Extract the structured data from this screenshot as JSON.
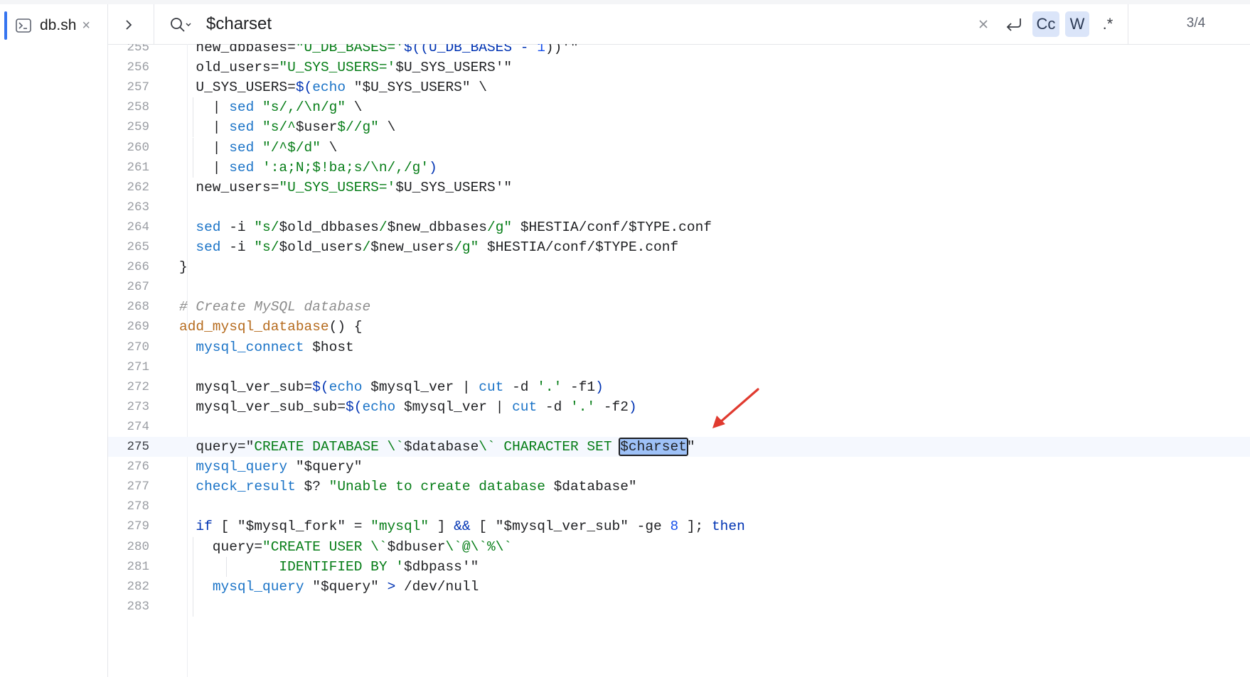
{
  "tab": {
    "label": "db.sh",
    "close": "×"
  },
  "search": {
    "query": "$charset",
    "match_counter": "3/4",
    "case_label": "Cc",
    "word_label": "W",
    "regex_label": ".*"
  },
  "editor": {
    "current_line": "275",
    "lines": [
      {
        "n": "255",
        "indent": 1
      },
      {
        "n": "256",
        "indent": 1
      },
      {
        "n": "257",
        "indent": 1
      },
      {
        "n": "258",
        "indent": 2
      },
      {
        "n": "259",
        "indent": 2
      },
      {
        "n": "260",
        "indent": 2
      },
      {
        "n": "261",
        "indent": 2
      },
      {
        "n": "262",
        "indent": 1
      },
      {
        "n": "263",
        "indent": 1
      },
      {
        "n": "264",
        "indent": 1
      },
      {
        "n": "265",
        "indent": 1
      },
      {
        "n": "266",
        "indent": 0
      },
      {
        "n": "267",
        "indent": 0
      },
      {
        "n": "268",
        "indent": 0
      },
      {
        "n": "269",
        "indent": 0
      },
      {
        "n": "270",
        "indent": 1
      },
      {
        "n": "271",
        "indent": 1
      },
      {
        "n": "272",
        "indent": 1
      },
      {
        "n": "273",
        "indent": 1
      },
      {
        "n": "274",
        "indent": 1
      },
      {
        "n": "275",
        "indent": 1
      },
      {
        "n": "276",
        "indent": 1
      },
      {
        "n": "277",
        "indent": 1
      },
      {
        "n": "278",
        "indent": 1
      },
      {
        "n": "279",
        "indent": 1
      },
      {
        "n": "280",
        "indent": 2
      },
      {
        "n": "281",
        "indent": 3
      },
      {
        "n": "282",
        "indent": 2
      },
      {
        "n": "283",
        "indent": 2
      }
    ],
    "code": [
      [
        {
          "t": "  new_dbbases="
        },
        {
          "c": "t-s",
          "t": "\"U_DB_BASES='"
        },
        {
          "c": "t-k",
          "t": "$((U_DB_BASES - "
        },
        {
          "c": "t-n",
          "t": "1"
        },
        {
          "t": "))'\""
        }
      ],
      [
        {
          "t": "  old_users="
        },
        {
          "c": "t-s",
          "t": "\"U_SYS_USERS='"
        },
        {
          "t": "$U_SYS_USERS'\""
        }
      ],
      [
        {
          "t": "  U_SYS_USERS="
        },
        {
          "c": "t-k",
          "t": "$("
        },
        {
          "c": "t-f",
          "t": "echo "
        },
        {
          "t": "\"$U_SYS_USERS\" \\"
        }
      ],
      [
        {
          "t": "    | "
        },
        {
          "c": "t-f",
          "t": "sed "
        },
        {
          "c": "t-s",
          "t": "\"s/,/\\n/g\""
        },
        {
          "t": " \\"
        }
      ],
      [
        {
          "t": "    | "
        },
        {
          "c": "t-f",
          "t": "sed "
        },
        {
          "c": "t-s",
          "t": "\"s/^"
        },
        {
          "t": "$user"
        },
        {
          "c": "t-s",
          "t": "$//g\""
        },
        {
          "t": " \\"
        }
      ],
      [
        {
          "t": "    | "
        },
        {
          "c": "t-f",
          "t": "sed "
        },
        {
          "c": "t-s",
          "t": "\"/^$/d\""
        },
        {
          "t": " \\"
        }
      ],
      [
        {
          "t": "    | "
        },
        {
          "c": "t-f",
          "t": "sed "
        },
        {
          "c": "t-s",
          "t": "':a;N;$!ba;s/\\n/,/g'"
        },
        {
          "c": "t-k",
          "t": ")"
        }
      ],
      [
        {
          "t": "  new_users="
        },
        {
          "c": "t-s",
          "t": "\"U_SYS_USERS='"
        },
        {
          "t": "$U_SYS_USERS'\""
        }
      ],
      [
        {
          "t": ""
        }
      ],
      [
        {
          "t": "  "
        },
        {
          "c": "t-f",
          "t": "sed"
        },
        {
          "t": " -i "
        },
        {
          "c": "t-s",
          "t": "\"s/"
        },
        {
          "t": "$old_dbbases"
        },
        {
          "c": "t-s",
          "t": "/"
        },
        {
          "t": "$new_dbbases"
        },
        {
          "c": "t-s",
          "t": "/g\""
        },
        {
          "t": " $HESTIA/conf/$TYPE.conf"
        }
      ],
      [
        {
          "t": "  "
        },
        {
          "c": "t-f",
          "t": "sed"
        },
        {
          "t": " -i "
        },
        {
          "c": "t-s",
          "t": "\"s/"
        },
        {
          "t": "$old_users"
        },
        {
          "c": "t-s",
          "t": "/"
        },
        {
          "t": "$new_users"
        },
        {
          "c": "t-s",
          "t": "/g\""
        },
        {
          "t": " $HESTIA/conf/$TYPE.conf"
        }
      ],
      [
        {
          "t": "}"
        }
      ],
      [
        {
          "t": ""
        }
      ],
      [
        {
          "c": "t-c",
          "t": "# Create MySQL database"
        }
      ],
      [
        {
          "c": "t-fn",
          "t": "add_mysql_database"
        },
        {
          "t": "() {"
        }
      ],
      [
        {
          "t": "  "
        },
        {
          "c": "t-f",
          "t": "mysql_connect"
        },
        {
          "t": " $host"
        }
      ],
      [
        {
          "t": ""
        }
      ],
      [
        {
          "t": "  mysql_ver_sub="
        },
        {
          "c": "t-k",
          "t": "$("
        },
        {
          "c": "t-f",
          "t": "echo"
        },
        {
          "t": " $mysql_ver | "
        },
        {
          "c": "t-f",
          "t": "cut"
        },
        {
          "t": " -d "
        },
        {
          "c": "t-s",
          "t": "'.'"
        },
        {
          "t": " -f1"
        },
        {
          "c": "t-k",
          "t": ")"
        }
      ],
      [
        {
          "t": "  mysql_ver_sub_sub="
        },
        {
          "c": "t-k",
          "t": "$("
        },
        {
          "c": "t-f",
          "t": "echo"
        },
        {
          "t": " $mysql_ver | "
        },
        {
          "c": "t-f",
          "t": "cut"
        },
        {
          "t": " -d "
        },
        {
          "c": "t-s",
          "t": "'.'"
        },
        {
          "t": " -f2"
        },
        {
          "c": "t-k",
          "t": ")"
        }
      ],
      [
        {
          "t": ""
        }
      ],
      [
        {
          "t": "  query=\""
        },
        {
          "c": "t-s",
          "t": "CREATE DATABASE \\`"
        },
        {
          "t": "$database"
        },
        {
          "c": "t-s",
          "t": "\\` CHARACTER SET "
        },
        {
          "c": "hl",
          "t": "$charset"
        },
        {
          "t": "\""
        }
      ],
      [
        {
          "t": "  "
        },
        {
          "c": "t-f",
          "t": "mysql_query"
        },
        {
          "t": " \"$query\""
        }
      ],
      [
        {
          "t": "  "
        },
        {
          "c": "t-f",
          "t": "check_result"
        },
        {
          "t": " $? "
        },
        {
          "c": "t-s",
          "t": "\"Unable to create database "
        },
        {
          "t": "$database\""
        }
      ],
      [
        {
          "t": ""
        }
      ],
      [
        {
          "t": "  "
        },
        {
          "c": "t-k",
          "t": "if"
        },
        {
          "t": " [ \"$mysql_fork\" = "
        },
        {
          "c": "t-s",
          "t": "\"mysql\""
        },
        {
          "t": " ] "
        },
        {
          "c": "t-k",
          "t": "&&"
        },
        {
          "t": " [ \"$mysql_ver_sub\" -ge "
        },
        {
          "c": "t-n",
          "t": "8"
        },
        {
          "t": " ]; "
        },
        {
          "c": "t-k",
          "t": "then"
        }
      ],
      [
        {
          "t": "    query="
        },
        {
          "c": "t-s",
          "t": "\"CREATE USER \\`"
        },
        {
          "t": "$dbuser"
        },
        {
          "c": "t-s",
          "t": "\\`@\\`%\\`"
        }
      ],
      [
        {
          "c": "t-s",
          "t": "            IDENTIFIED BY '"
        },
        {
          "t": "$dbpass'\""
        }
      ],
      [
        {
          "t": "    "
        },
        {
          "c": "t-f",
          "t": "mysql_query"
        },
        {
          "t": " \"$query\" "
        },
        {
          "c": "t-k",
          "t": ">"
        },
        {
          "t": " /dev/null"
        }
      ],
      [
        {
          "t": ""
        }
      ]
    ]
  },
  "colors": {
    "accent": "#3574f0",
    "match_highlight": "#9ec1f7",
    "arrow": "#e03a2f"
  },
  "icons": [
    "terminal-icon",
    "close-icon",
    "chevron-right-icon",
    "search-icon",
    "clear-icon",
    "replace-icon",
    "case-sensitive-icon",
    "whole-word-icon",
    "regex-icon",
    "arrow-annotation"
  ]
}
